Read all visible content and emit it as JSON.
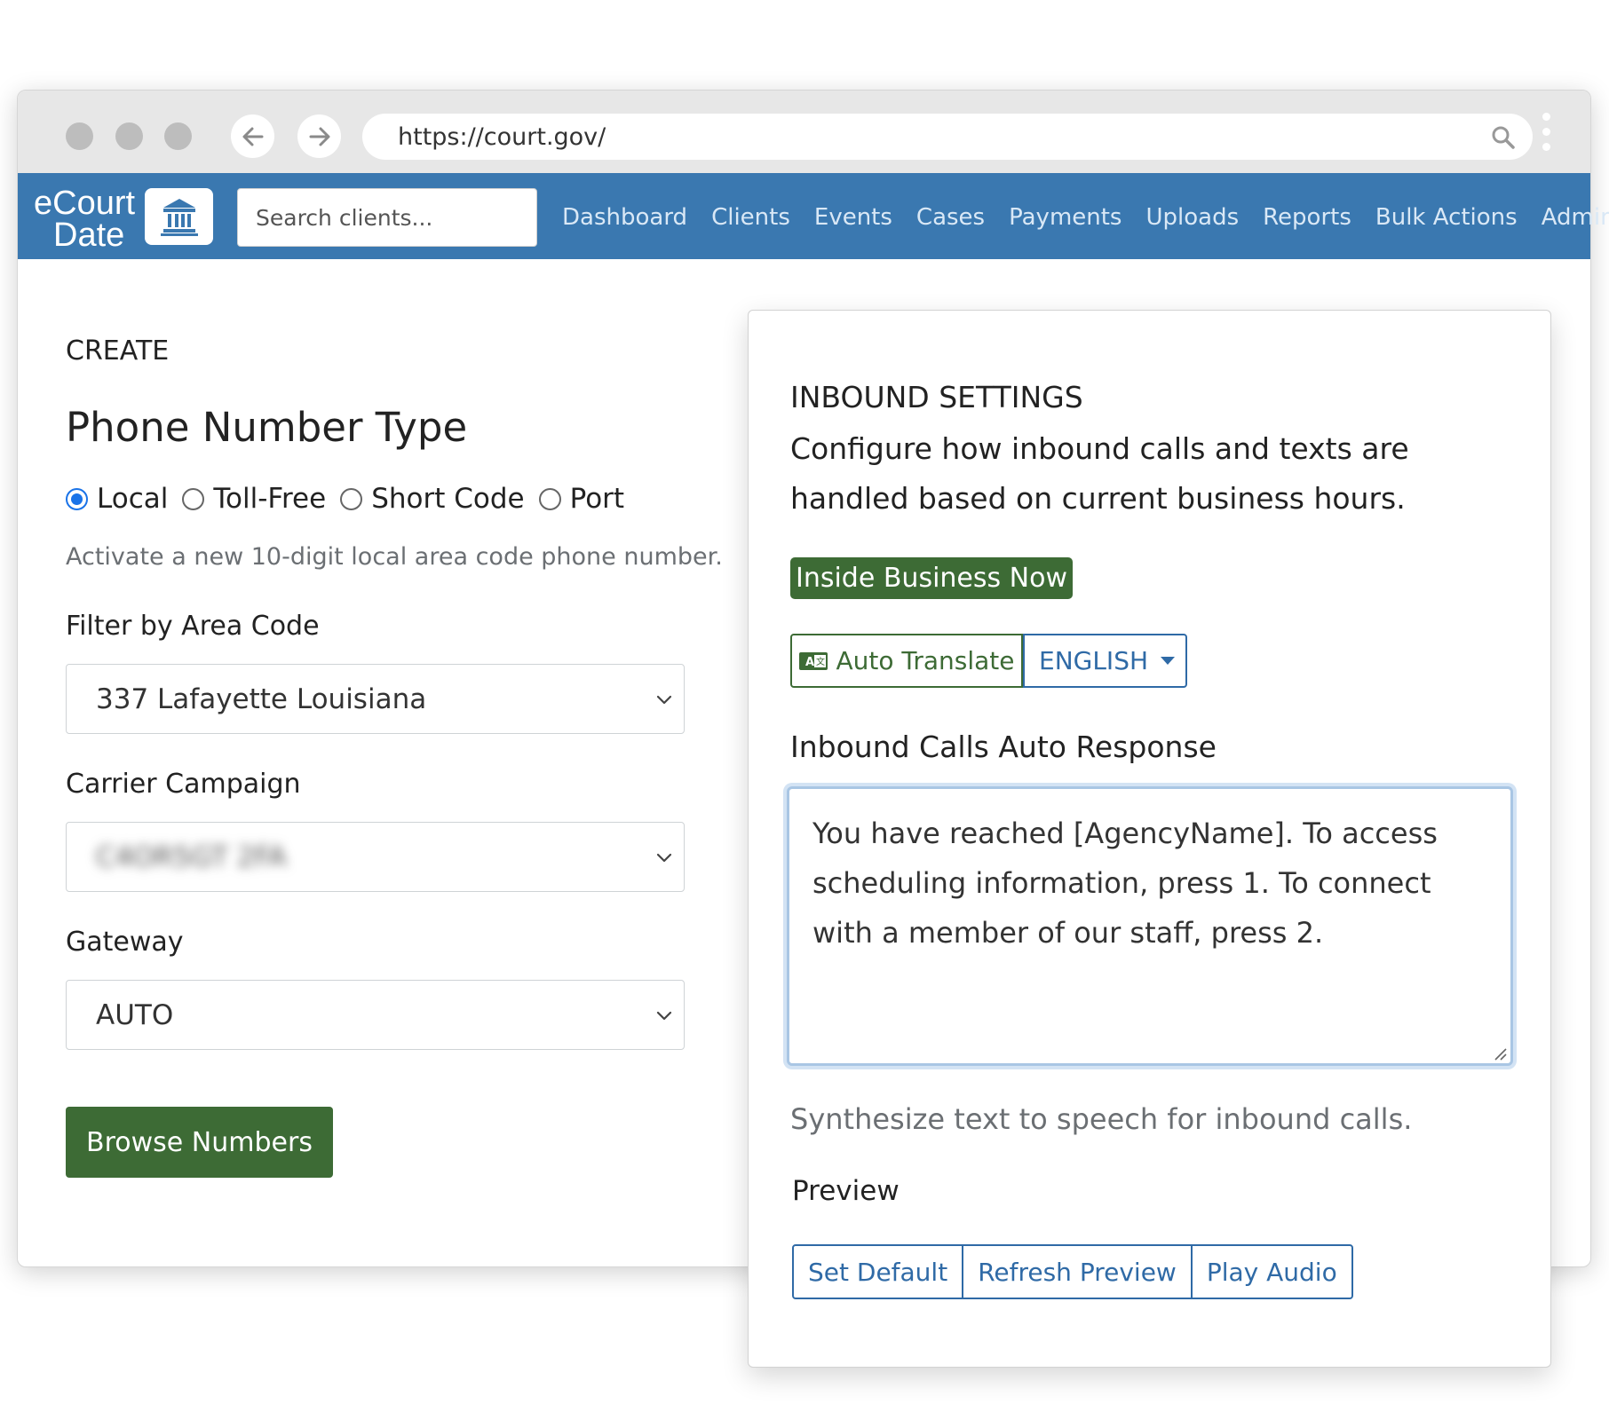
{
  "browser": {
    "url": "https://court.gov/"
  },
  "app": {
    "logo_line1": "eCourt",
    "logo_line2": "Date",
    "search_placeholder": "Search clients...",
    "nav": [
      "Dashboard",
      "Clients",
      "Events",
      "Cases",
      "Payments",
      "Uploads",
      "Reports",
      "Bulk Actions",
      "Admin"
    ]
  },
  "create": {
    "section_label": "CREATE",
    "title": "Phone Number Type",
    "radio_options": [
      {
        "label": "Local",
        "checked": true
      },
      {
        "label": "Toll-Free",
        "checked": false
      },
      {
        "label": "Short Code",
        "checked": false
      },
      {
        "label": "Port",
        "checked": false
      }
    ],
    "help_text": "Activate a new 10-digit local area code phone number.",
    "area_code_label": "Filter by Area Code",
    "area_code_value": "337 Lafayette Louisiana",
    "carrier_label": "Carrier Campaign",
    "carrier_value": "C4OR5GT 2FA",
    "gateway_label": "Gateway",
    "gateway_value": "AUTO",
    "browse_button": "Browse Numbers"
  },
  "inbound": {
    "title": "INBOUND SETTINGS",
    "description": "Configure how inbound calls and texts are handled based on current business hours.",
    "status_badge": "Inside Business Now",
    "auto_translate": "Auto Translate",
    "language": "ENGLISH",
    "auto_response_label": "Inbound Calls Auto Response",
    "auto_response_text": "You have reached [AgencyName]. To access scheduling information, press 1. To connect with a member of our staff, press 2.",
    "synth_help": "Synthesize text to speech for inbound calls.",
    "preview_label": "Preview",
    "buttons": {
      "set_default": "Set Default",
      "refresh_preview": "Refresh Preview",
      "play_audio": "Play Audio"
    }
  },
  "colors": {
    "nav_blue": "#3a78b0",
    "brand_green": "#3d6b35",
    "link_blue": "#2f6aa6"
  }
}
